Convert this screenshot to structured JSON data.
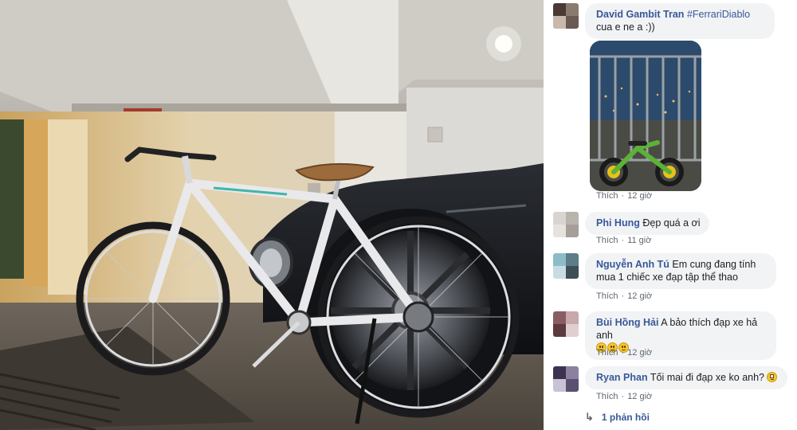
{
  "comments": [
    {
      "name": "David Gambit Tran",
      "tag": "#FerrariDiablo",
      "text": " cua e ne a :))",
      "like": "Thích",
      "time": "12 giờ",
      "avatar_colors": [
        "#4b3a34",
        "#8a7a70",
        "#c9b9ad",
        "#6b5a52"
      ]
    },
    {
      "name": "Phi Hung",
      "text": "Đẹp quá a ơi",
      "like": "Thích",
      "time": "11 giờ",
      "avatar_colors": [
        "#d8d4d1",
        "#b9b3ae",
        "#e6e2de",
        "#a69f99"
      ]
    },
    {
      "name": "Nguyễn Anh Tú",
      "text": "Em cung đang tính mua 1 chiếc xe đạp tập thể thao",
      "like": "Thích",
      "time": "12 giờ",
      "avatar_colors": [
        "#8dbcc9",
        "#5d7d88",
        "#c8dde3",
        "#3f4f56"
      ]
    },
    {
      "name": "Bùi Hồng Hải",
      "text": "A bảo thích đạp xe hả anh",
      "emoji_count": 3,
      "like": "Thích",
      "time": "12 giờ",
      "avatar_colors": [
        "#8a5d62",
        "#c8a8ab",
        "#5b3b40",
        "#e0cfd0"
      ]
    },
    {
      "name": "Ryan Phan",
      "text": "Tối mai đi đạp xe ko anh?",
      "like": "Thích",
      "time": "12 giờ",
      "avatar_colors": [
        "#3d3350",
        "#8c82a0",
        "#c9c2d6",
        "#5b5070"
      ]
    }
  ],
  "replies_label": "1 phản hồi",
  "icons": {
    "reply": "reply-arrow-icon",
    "emoji_smile": "smile-emoji-icon",
    "emoji_roll": "eye-roll-emoji-icon"
  },
  "colors": {
    "name_link": "#385898",
    "bubble_bg": "#f2f3f5",
    "meta_text": "#606770"
  }
}
